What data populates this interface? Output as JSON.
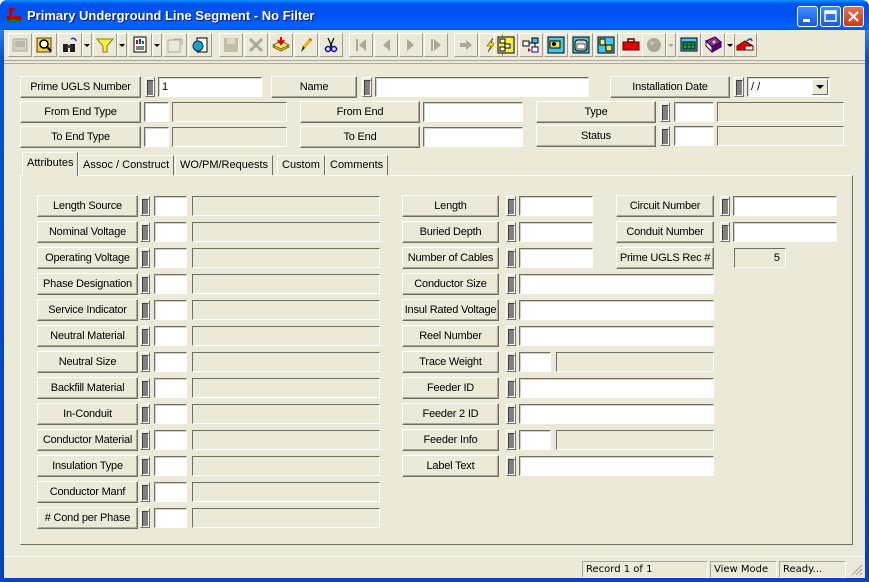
{
  "window": {
    "title": "Primary Underground Line Segment - No Filter",
    "controls": [
      "minimize",
      "maximize",
      "close"
    ]
  },
  "toolbar": {
    "buttons": [
      {
        "name": "grid-view",
        "icon": "grid-icon",
        "enabled": false
      },
      {
        "name": "search",
        "icon": "magnifier-book-icon",
        "enabled": true
      },
      {
        "name": "find",
        "icon": "binoculars-icon",
        "enabled": true,
        "dropdown": true
      },
      {
        "name": "filter",
        "icon": "funnel-icon",
        "enabled": true,
        "dropdown": true
      },
      {
        "name": "report",
        "icon": "report-icon",
        "enabled": true,
        "dropdown": true
      },
      {
        "name": "properties",
        "icon": "properties-icon",
        "enabled": false
      },
      {
        "name": "export",
        "icon": "export-icon",
        "enabled": true
      },
      {
        "name": "save",
        "icon": "save-icon",
        "enabled": false
      },
      {
        "name": "delete",
        "icon": "delete-icon",
        "enabled": false
      },
      {
        "name": "new-record",
        "icon": "stack-add-icon",
        "enabled": true
      },
      {
        "name": "edit",
        "icon": "pencil-icon",
        "enabled": true
      },
      {
        "name": "cut",
        "icon": "scissors-icon",
        "enabled": true
      },
      {
        "name": "first-record",
        "icon": "first-icon",
        "enabled": false
      },
      {
        "name": "previous-record",
        "icon": "previous-icon",
        "enabled": false
      },
      {
        "name": "next-record",
        "icon": "next-icon",
        "enabled": false
      },
      {
        "name": "last-record",
        "icon": "last-icon",
        "enabled": false
      },
      {
        "name": "go-to",
        "icon": "arrow-right-icon",
        "enabled": false
      },
      {
        "name": "trace",
        "icon": "lightning-icon",
        "enabled": true
      },
      {
        "name": "hierarchy",
        "icon": "hierarchy-icon",
        "enabled": true
      },
      {
        "name": "relations",
        "icon": "relations-icon",
        "enabled": true
      },
      {
        "name": "map",
        "icon": "map-icon",
        "enabled": true
      },
      {
        "name": "calculator",
        "icon": "calculator-icon",
        "enabled": true
      },
      {
        "name": "drawing",
        "icon": "drawing-icon",
        "enabled": true
      },
      {
        "name": "toolbox",
        "icon": "toolbox-icon",
        "enabled": true
      },
      {
        "name": "globe",
        "icon": "globe-icon",
        "enabled": false,
        "dropdown": true
      },
      {
        "name": "spreadsheet",
        "icon": "spreadsheet-icon",
        "enabled": true
      },
      {
        "name": "help-book",
        "icon": "help-book-icon",
        "enabled": true,
        "dropdown": true
      },
      {
        "name": "exit",
        "icon": "exit-icon",
        "enabled": true
      }
    ]
  },
  "header": {
    "prime_ugls_number": {
      "label": "Prime UGLS Number",
      "value": "1"
    },
    "name": {
      "label": "Name",
      "value": ""
    },
    "installation_date": {
      "label": "Installation Date",
      "value": " /  /"
    },
    "from_end_type": {
      "label": "From End Type",
      "code": "",
      "desc": ""
    },
    "from_end": {
      "label": "From End",
      "value": ""
    },
    "type": {
      "label": "Type",
      "code": "",
      "desc": ""
    },
    "to_end_type": {
      "label": "To End Type",
      "code": "",
      "desc": ""
    },
    "to_end": {
      "label": "To End",
      "value": ""
    },
    "status": {
      "label": "Status",
      "code": "",
      "desc": ""
    }
  },
  "tabs": [
    {
      "label": "Attributes",
      "active": true
    },
    {
      "label": "Assoc / Construct",
      "active": false
    },
    {
      "label": "WO/PM/Requests",
      "active": false
    },
    {
      "label": "Custom",
      "active": false
    },
    {
      "label": "Comments",
      "active": false
    }
  ],
  "attributes": {
    "left": [
      {
        "label": "Length Source",
        "code": "",
        "desc": ""
      },
      {
        "label": "Nominal Voltage",
        "code": "",
        "desc": ""
      },
      {
        "label": "Operating Voltage",
        "code": "",
        "desc": ""
      },
      {
        "label": "Phase Designation",
        "code": "",
        "desc": ""
      },
      {
        "label": "Service Indicator",
        "code": "",
        "desc": ""
      },
      {
        "label": "Neutral Material",
        "code": "",
        "desc": ""
      },
      {
        "label": "Neutral Size",
        "code": "",
        "desc": ""
      },
      {
        "label": "Backfill Material",
        "code": "",
        "desc": ""
      },
      {
        "label": "In-Conduit",
        "code": "",
        "desc": ""
      },
      {
        "label": "Conductor Material",
        "code": "",
        "desc": ""
      },
      {
        "label": "Insulation Type",
        "code": "",
        "desc": ""
      },
      {
        "label": "Conductor Manf",
        "code": "",
        "desc": ""
      },
      {
        "label": "# Cond per Phase",
        "code": "",
        "desc": ""
      }
    ],
    "middle": [
      {
        "label": "Length",
        "value": ""
      },
      {
        "label": "Buried Depth",
        "value": ""
      },
      {
        "label": "Number of Cables",
        "value": ""
      },
      {
        "label": "Conductor Size",
        "value": ""
      },
      {
        "label": "Insul Rated Voltage",
        "value": ""
      },
      {
        "label": "Reel Number",
        "value": ""
      },
      {
        "label": "Trace Weight",
        "code": "",
        "desc": ""
      },
      {
        "label": "Feeder ID",
        "value": ""
      },
      {
        "label": "Feeder 2 ID",
        "value": ""
      },
      {
        "label": "Feeder Info",
        "code": "",
        "desc": ""
      },
      {
        "label": "Label Text",
        "value": ""
      }
    ],
    "right": [
      {
        "label": "Circuit Number",
        "value": ""
      },
      {
        "label": "Conduit Number",
        "value": ""
      },
      {
        "label": "Prime UGLS Rec #",
        "value": "5"
      }
    ]
  },
  "statusbar": {
    "record": "Record 1 of 1",
    "mode": "View Mode",
    "state": "Ready..."
  }
}
